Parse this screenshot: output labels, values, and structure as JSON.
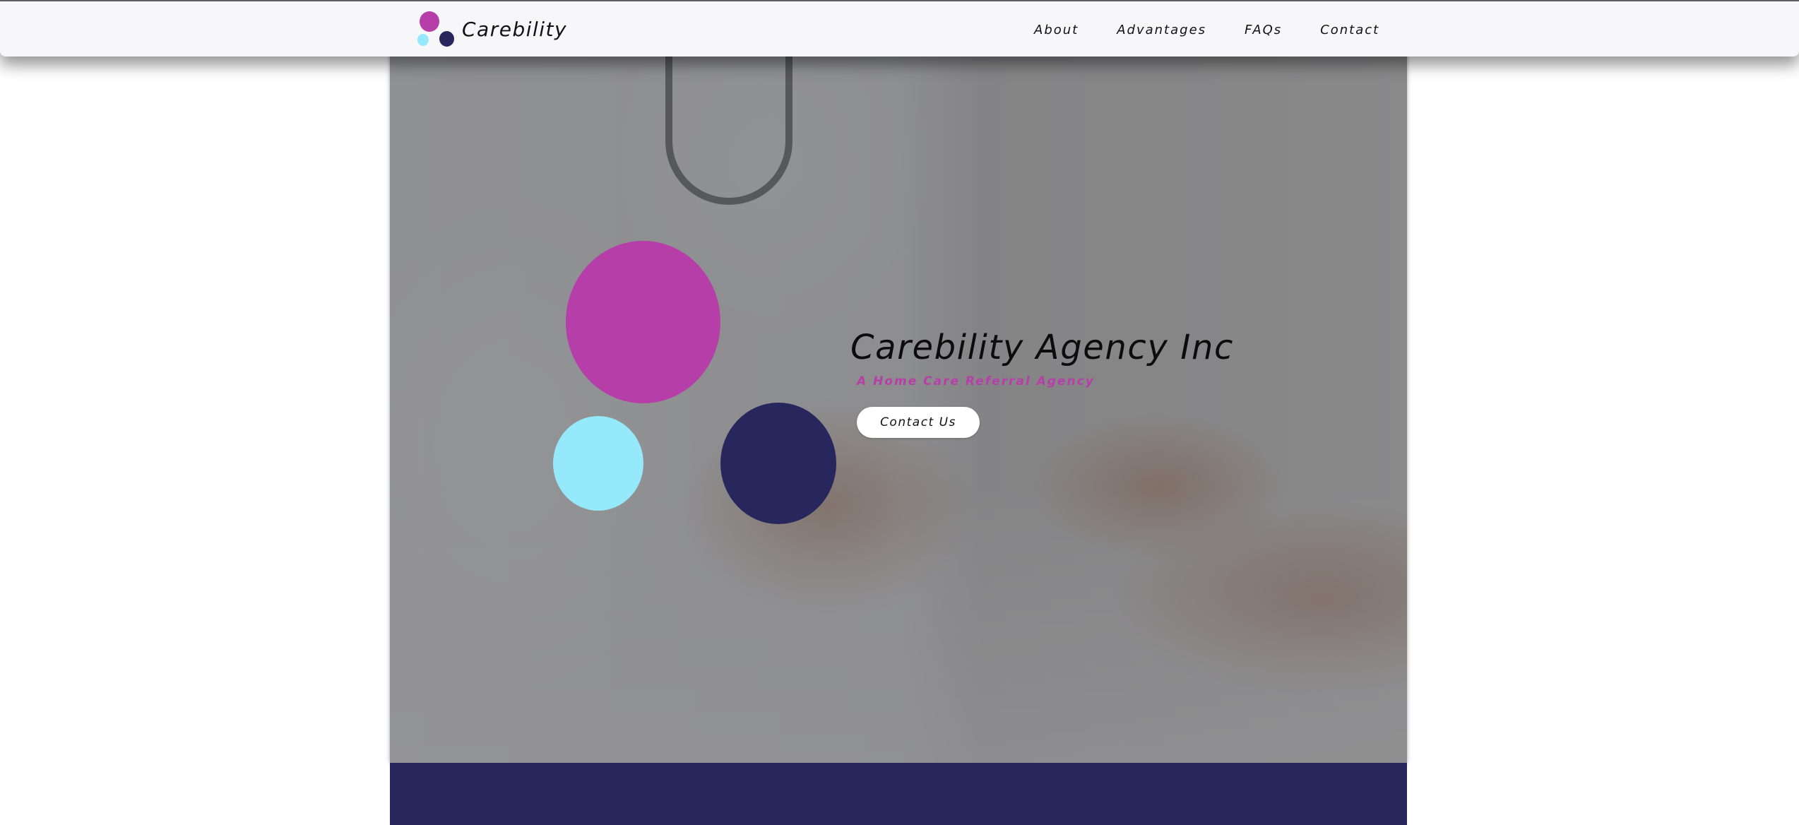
{
  "colors": {
    "magenta": "#b63ea9",
    "cyan": "#96e8fb",
    "navy": "#27275e",
    "navbar_bg": "#f7f7f9",
    "text": "#111111"
  },
  "header": {
    "logo_icon": "three-dots-logo-icon",
    "brand_name": "Carebility",
    "nav": [
      {
        "label": "About"
      },
      {
        "label": "Advantages"
      },
      {
        "label": "FAQs"
      },
      {
        "label": "Contact"
      }
    ]
  },
  "hero": {
    "title": "Carebility Agency Inc",
    "subtitle": "A Home Care Referral Agency",
    "cta_label": "Contact Us",
    "background_image": "doctor-holding-patient-hands-photo"
  }
}
